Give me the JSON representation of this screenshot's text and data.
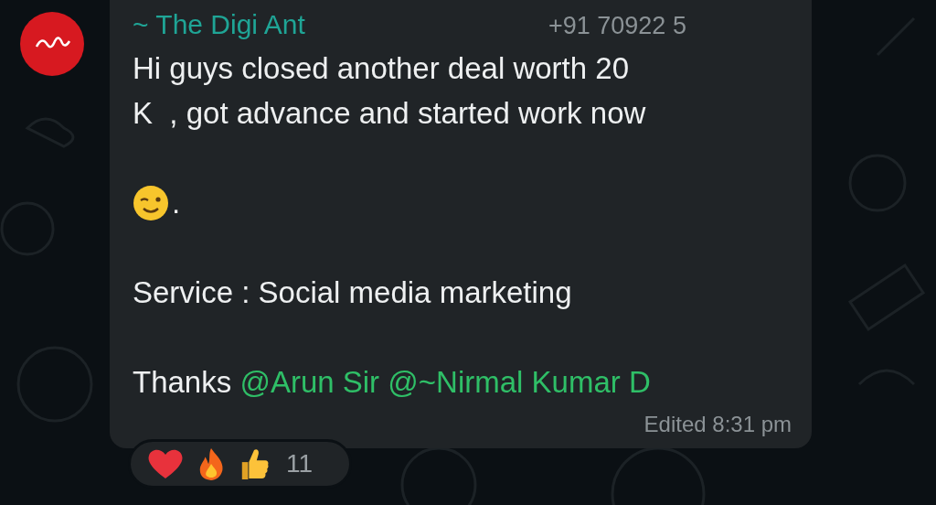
{
  "message": {
    "sender": "~ The Digi Ant",
    "phone": "+91 70922 5",
    "blocks": [
      {
        "kind": "text",
        "lines": [
          "Hi guys closed another deal worth 20",
          "K  , got advance and started work now"
        ]
      },
      {
        "kind": "emoji_line",
        "text": "."
      },
      {
        "kind": "text",
        "lines": [
          "Service : Social media marketing"
        ]
      },
      {
        "kind": "mentions",
        "text": "Thanks ",
        "mentions": [
          "@Arun Sir",
          "@~Nirmal Kumar D"
        ]
      }
    ],
    "edited": "Edited",
    "time": "8:31 pm"
  },
  "reactions": {
    "count": "11"
  }
}
